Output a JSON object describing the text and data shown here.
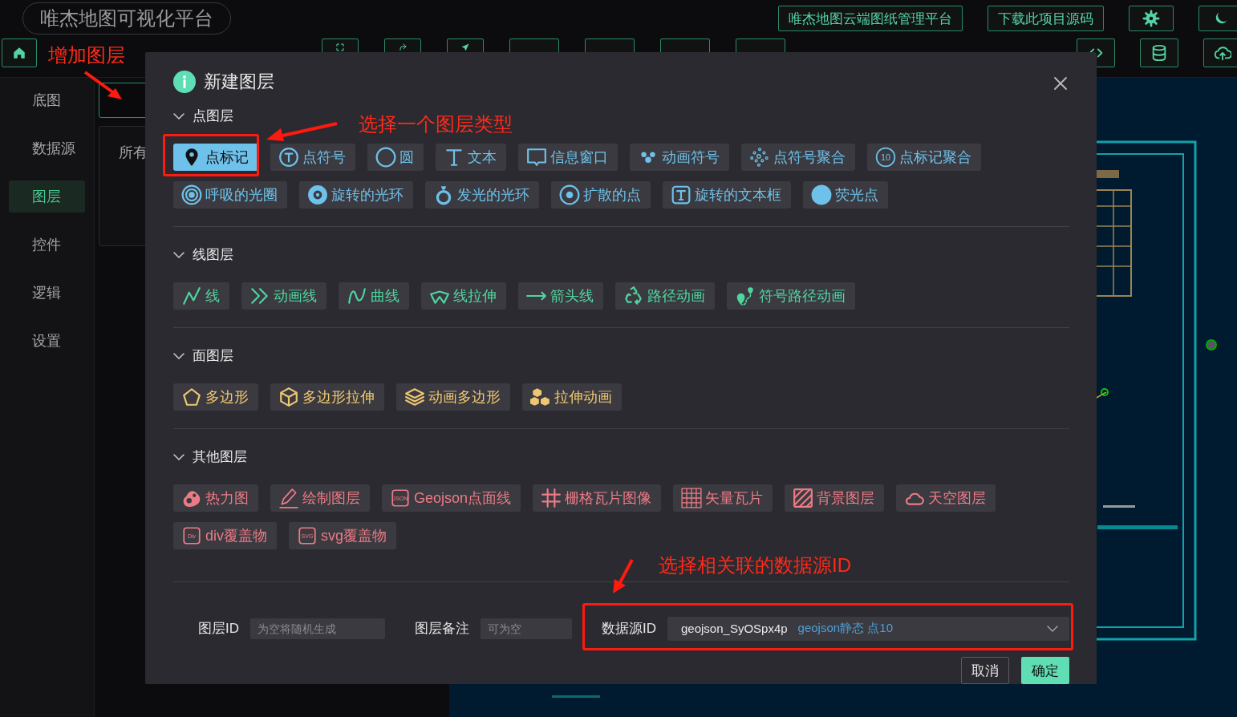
{
  "app": {
    "title": "唯杰地图可视化平台"
  },
  "header_buttons": [
    {
      "kind": "text",
      "label": "唯杰地图云端图纸管理平台"
    },
    {
      "kind": "text",
      "label": "下载此项目源码"
    },
    {
      "kind": "icon"
    },
    {
      "kind": "icon"
    }
  ],
  "toolbar": [
    {
      "kind": "icon"
    },
    {
      "kind": "icon"
    },
    {
      "kind": "icon"
    },
    {
      "kind": "text"
    },
    {
      "kind": "text"
    },
    {
      "kind": "text"
    },
    {
      "kind": "text"
    }
  ],
  "toolbar_right": [
    {
      "kind": "icon"
    },
    {
      "kind": "icon"
    },
    {
      "kind": "icon"
    }
  ],
  "sidebar": {
    "items": [
      {
        "label": "底图",
        "selected": false
      },
      {
        "label": "数据源",
        "selected": false
      },
      {
        "label": "图层",
        "selected": true
      },
      {
        "label": "控件",
        "selected": false
      },
      {
        "label": "逻辑",
        "selected": false
      },
      {
        "label": "设置",
        "selected": false
      }
    ]
  },
  "layer_panel": {
    "tab_label": "所有"
  },
  "dialog": {
    "title": "新建图层",
    "sections": [
      {
        "title": "点图层",
        "kind": "point",
        "expanded": true,
        "items": [
          {
            "label": "点标记",
            "selected": true
          },
          {
            "label": "点符号",
            "selected": false
          },
          {
            "label": "圆",
            "selected": false
          },
          {
            "label": "文本",
            "selected": false
          },
          {
            "label": "信息窗口",
            "selected": false
          },
          {
            "label": "动画符号",
            "selected": false
          },
          {
            "label": "点符号聚合",
            "selected": false
          },
          {
            "label": "点标记聚合",
            "selected": false,
            "icon_text": "10"
          },
          {
            "label": "呼吸的光圈",
            "selected": false
          },
          {
            "label": "旋转的光环",
            "selected": false
          },
          {
            "label": "发光的光环",
            "selected": false
          },
          {
            "label": "扩散的点",
            "selected": false
          },
          {
            "label": "旋转的文本框",
            "selected": false
          },
          {
            "label": "荧光点",
            "selected": false
          }
        ]
      },
      {
        "title": "线图层",
        "kind": "line",
        "expanded": true,
        "items": [
          {
            "label": "线",
            "selected": false
          },
          {
            "label": "动画线",
            "selected": false
          },
          {
            "label": "曲线",
            "selected": false
          },
          {
            "label": "线拉伸",
            "selected": false
          },
          {
            "label": "箭头线",
            "selected": false
          },
          {
            "label": "路径动画",
            "selected": false
          },
          {
            "label": "符号路径动画",
            "selected": false
          }
        ]
      },
      {
        "title": "面图层",
        "kind": "polygon",
        "expanded": true,
        "items": [
          {
            "label": "多边形",
            "selected": false
          },
          {
            "label": "多边形拉伸",
            "selected": false
          },
          {
            "label": "动画多边形",
            "selected": false
          },
          {
            "label": "拉伸动画",
            "selected": false
          }
        ]
      },
      {
        "title": "其他图层",
        "kind": "other",
        "expanded": true,
        "items": [
          {
            "label": "热力图",
            "selected": false
          },
          {
            "label": "绘制图层",
            "selected": false
          },
          {
            "label": "Geojson点面线",
            "selected": false,
            "icon_text": "JSON"
          },
          {
            "label": "栅格瓦片图像",
            "selected": false
          },
          {
            "label": "矢量瓦片",
            "selected": false
          },
          {
            "label": "背景图层",
            "selected": false
          },
          {
            "label": "天空图层",
            "selected": false
          },
          {
            "label": "div覆盖物",
            "selected": false,
            "icon_text": "Div"
          },
          {
            "label": "svg覆盖物",
            "selected": false,
            "icon_text": "SVG"
          }
        ]
      }
    ],
    "fields": [
      {
        "label": "图层ID",
        "placeholder": "为空将随机生成"
      },
      {
        "label": "图层备注",
        "placeholder": "可为空"
      }
    ],
    "datasource": {
      "label": "数据源ID",
      "value": "geojson_SyOSpx4p",
      "detail": "geojson静态 点10"
    },
    "buttons": [
      {
        "label": "取消",
        "kind": "secondary"
      },
      {
        "label": "确定",
        "kind": "primary"
      }
    ]
  },
  "annotations": [
    {
      "text": "增加图层"
    },
    {
      "text": "选择一个图层类型"
    },
    {
      "text": "选择相关联的数据源ID"
    }
  ]
}
